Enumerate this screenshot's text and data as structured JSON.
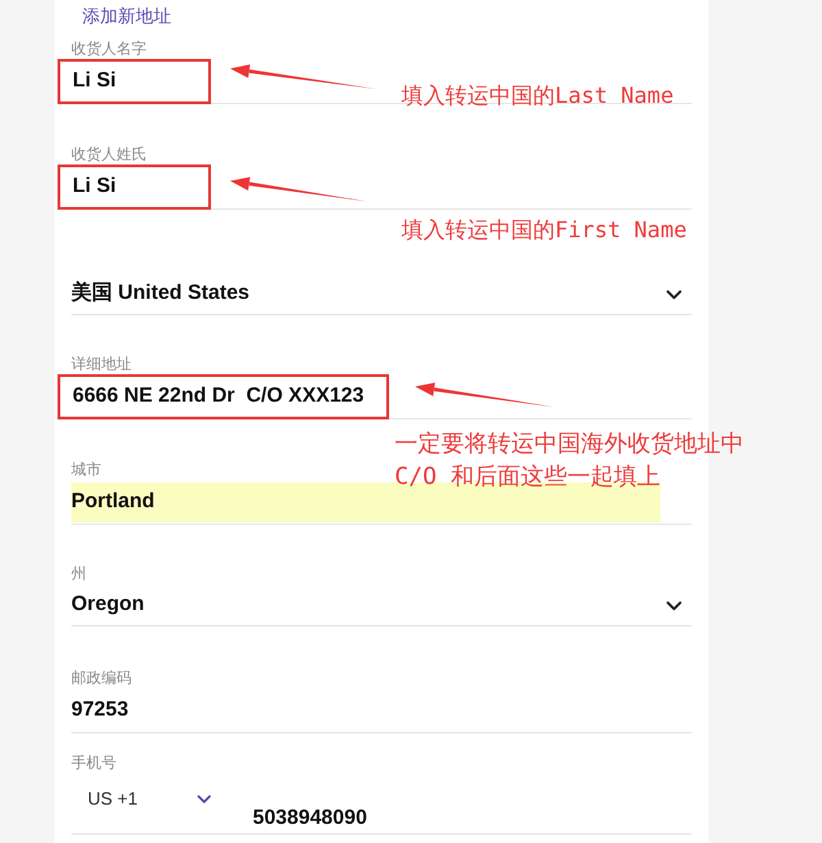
{
  "link": "添加新地址",
  "fields": [
    {
      "kind": "text",
      "label": "收货人名字",
      "value": "Li Si",
      "highlighted": true,
      "autofilled": false
    },
    {
      "kind": "text",
      "label": "收货人姓氏",
      "value": "Li Si",
      "highlighted": true,
      "autofilled": false
    },
    {
      "kind": "select",
      "value": "美国 United States",
      "highlighted": false,
      "autofilled": false
    },
    {
      "kind": "text",
      "label": "详细地址",
      "value": "6666 NE 22nd Dr  C/O XXX123",
      "highlighted": true,
      "autofilled": false
    },
    {
      "kind": "text",
      "label": "城市",
      "value": "Portland",
      "highlighted": false,
      "autofilled": true
    },
    {
      "kind": "select",
      "label": "州",
      "value": "Oregon",
      "highlighted": false,
      "autofilled": false
    },
    {
      "kind": "text",
      "label": "邮政编码",
      "value": "97253",
      "highlighted": false,
      "autofilled": false
    },
    {
      "kind": "phone",
      "label": "手机号",
      "country_code": "US +1",
      "value": "5038948090",
      "highlighted": false,
      "autofilled": false
    }
  ],
  "annotations": [
    {
      "lines": [
        "填入转运中国的Last Name"
      ]
    },
    {
      "lines": [
        "填入转运中国的First Name"
      ]
    },
    {
      "lines": [
        "一定要将转运中国海外收货地址中",
        "C/O 和后面这些一起填上"
      ]
    }
  ]
}
